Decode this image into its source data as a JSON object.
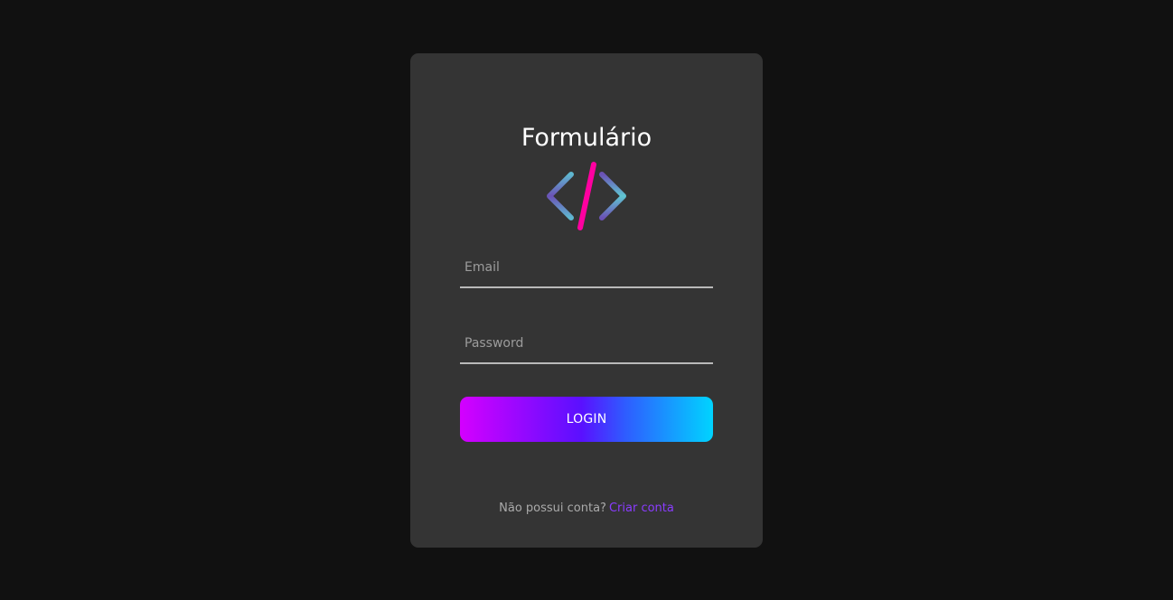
{
  "form": {
    "title": "Formulário",
    "logo_icon": "code-brackets-icon",
    "email": {
      "placeholder": "Email",
      "value": ""
    },
    "password": {
      "placeholder": "Password",
      "value": ""
    },
    "login_label": "LOGIN",
    "footer_text": "Não possui conta?",
    "signup_link": "Criar conta"
  },
  "colors": {
    "background": "#111111",
    "card": "#343434",
    "gradient_start": "#d400ff",
    "gradient_mid": "#5a10ff",
    "gradient_end": "#00d4ff",
    "link": "#8a3cff",
    "logo_slash": "#ff00a0"
  }
}
